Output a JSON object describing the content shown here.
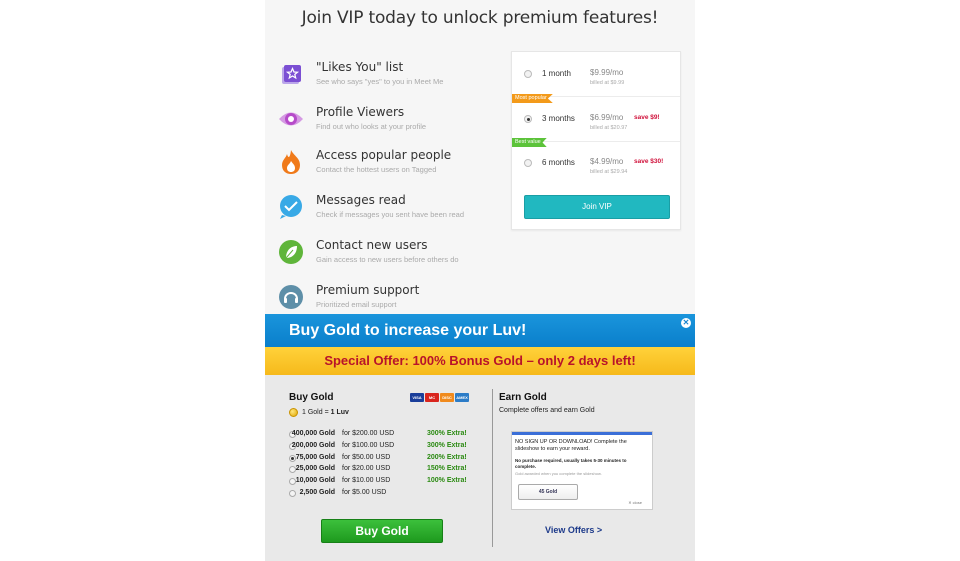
{
  "page_title": "Join VIP today to unlock premium features!",
  "features": [
    {
      "icon": "star-list-icon",
      "name": "\"Likes You\" list",
      "desc": "See who says \"yes\" to you in Meet Me",
      "color": "#7b4fd3"
    },
    {
      "icon": "eye-icon",
      "name": "Profile Viewers",
      "desc": "Find out who looks at your profile",
      "color": "#b64bc9"
    },
    {
      "icon": "flame-icon",
      "name": "Access popular people",
      "desc": "Contact the hottest users on Tagged",
      "color": "#f07a1a"
    },
    {
      "icon": "checkmark-bubble-icon",
      "name": "Messages read",
      "desc": "Check if messages you sent have been read",
      "color": "#38a9e6"
    },
    {
      "icon": "leaf-icon",
      "name": "Contact new users",
      "desc": "Gain access to new users before others do",
      "color": "#5fb53a"
    },
    {
      "icon": "headset-icon",
      "name": "Premium support",
      "desc": "Prioritized email support",
      "color": "#5e8fa8"
    }
  ],
  "plans": [
    {
      "duration": "1 month",
      "price": "$9.99/mo",
      "billed": "billed at $9.99",
      "save": "",
      "ribbon": "",
      "selected": false
    },
    {
      "duration": "3 months",
      "price": "$6.99/mo",
      "billed": "billed at $20.97",
      "save": "save $9!",
      "ribbon": "Most popular",
      "ribbon_color": "#f39a1a",
      "selected": true
    },
    {
      "duration": "6 months",
      "price": "$4.99/mo",
      "billed": "billed at $29.94",
      "save": "save $30!",
      "ribbon": "Best value",
      "ribbon_color": "#5cc33a",
      "selected": false
    }
  ],
  "join_button": "Join VIP",
  "gold": {
    "header": "Buy Gold to increase your Luv!",
    "offer": "Special Offer: 100% Bonus Gold – only 2 days left!",
    "buy_title": "Buy Gold",
    "rate_prefix": "1 Gold = ",
    "rate_value": "1 Luv",
    "packages": [
      {
        "amount": "400,000 Gold",
        "price": "for $200.00 USD",
        "extra": "300% Extra!",
        "selected": false
      },
      {
        "amount": "200,000 Gold",
        "price": "for $100.00 USD",
        "extra": "300% Extra!",
        "selected": false
      },
      {
        "amount": "75,000 Gold",
        "price": "for $50.00 USD",
        "extra": "200% Extra!",
        "selected": true
      },
      {
        "amount": "25,000 Gold",
        "price": "for $20.00 USD",
        "extra": "150% Extra!",
        "selected": false
      },
      {
        "amount": "10,000 Gold",
        "price": "for $10.00 USD",
        "extra": "100% Extra!",
        "selected": false
      },
      {
        "amount": "2,500 Gold",
        "price": "for $5.00 USD",
        "extra": "",
        "selected": false
      }
    ],
    "buy_button": "Buy Gold",
    "payment_cards": [
      {
        "name": "VISA",
        "color": "#1a3e9a"
      },
      {
        "name": "MC",
        "color": "#d9251d"
      },
      {
        "name": "DISC",
        "color": "#f08a1c"
      },
      {
        "name": "AMEX",
        "color": "#2c7cc7"
      }
    ],
    "earn_title": "Earn Gold",
    "earn_sub": "Complete offers and earn Gold",
    "offer_box": {
      "line1": "NO SIGN UP OR DOWNLOAD! Complete the slideshow to earn your reward.",
      "line2": "No purchase required, usually takes 5-30 minutes to complete.",
      "line3": "Gold awarded when you complete the slideshow.",
      "button": "45 Gold",
      "close": "✕ close"
    },
    "view_offers": "View Offers >",
    "close_symbol": "✕"
  }
}
